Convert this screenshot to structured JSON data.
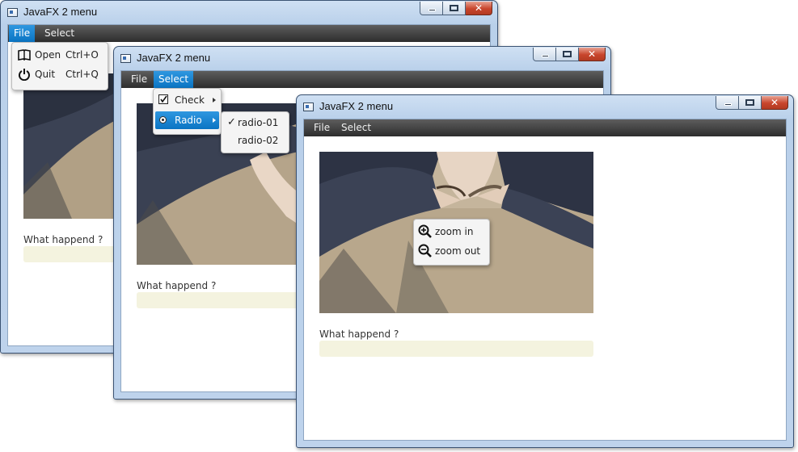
{
  "windows": [
    {
      "title": "JavaFX 2 menu",
      "menus": [
        "File",
        "Select"
      ],
      "field_label": "What happend ?"
    },
    {
      "title": "JavaFX 2 menu",
      "menus": [
        "File",
        "Select"
      ],
      "field_label": "What happend ?"
    },
    {
      "title": "JavaFX 2 menu",
      "menus": [
        "File",
        "Select"
      ],
      "field_label": "What happend ?"
    }
  ],
  "file_menu": {
    "items": [
      {
        "label": "Open",
        "accelerator": "Ctrl+O",
        "icon": "book-icon"
      },
      {
        "label": "Quit",
        "accelerator": "Ctrl+Q",
        "icon": "power-icon"
      }
    ]
  },
  "select_menu": {
    "items": [
      {
        "label": "Check",
        "icon": "checkbox-icon",
        "checked": true
      },
      {
        "label": "Radio",
        "icon": "radio-icon",
        "selected": true
      }
    ],
    "radio_submenu": [
      {
        "label": "radio-01",
        "checked": true
      },
      {
        "label": "radio-02",
        "checked": false
      }
    ]
  },
  "context_menu": {
    "items": [
      {
        "label": "zoom in",
        "icon": "zoom-in-icon"
      },
      {
        "label": "zoom out",
        "icon": "zoom-out-icon"
      }
    ]
  },
  "colors": {
    "menubar": "#3a3a3a",
    "highlight": "#0f7acb",
    "field_bg": "#f4f3df"
  }
}
